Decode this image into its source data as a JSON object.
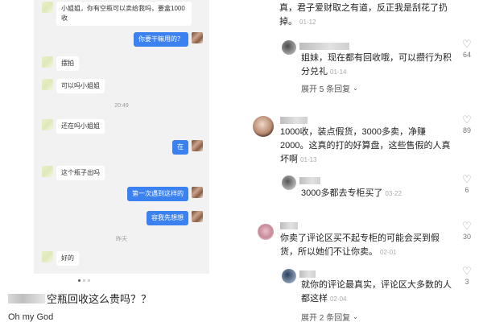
{
  "chat": {
    "messages": [
      {
        "side": "in",
        "text": "小姐姐，你有空瓶可以卖给我吗，要盒1000收"
      },
      {
        "side": "out",
        "text": "你要干嘛用的？"
      },
      {
        "side": "in",
        "text": "摆拍"
      },
      {
        "side": "in",
        "text": "可以吗小姐姐"
      },
      {
        "side": "in",
        "text": "还在吗小姐姐"
      },
      {
        "side": "out",
        "text": "在"
      },
      {
        "side": "in",
        "text": "这个瓶子出吗"
      },
      {
        "side": "out",
        "text": "第一次遇到这样的"
      },
      {
        "side": "out",
        "text": "容我先想想"
      },
      {
        "side": "in",
        "text": "好的"
      }
    ],
    "time_1": "20:49",
    "time_2": "昨天"
  },
  "post": {
    "title": "空瓶回收这么贵吗？？",
    "body": "Oh my God"
  },
  "comments": [
    {
      "name": "",
      "text": "真，君子爱财取之有道，反正我是刮花了扔掉。",
      "date": "01-12",
      "likes": "",
      "replies_link": ""
    },
    {
      "name": "",
      "text": "姐妹，现在都有回收哦，可以攒行为积分兑礼",
      "date": "01-14",
      "likes": "64",
      "replies_link": "展开 5 条回复"
    },
    {
      "name": "",
      "text": "1000收，装点假货，3000多卖，净赚2000。这真的打的好算盘，这些售假的人真坏啊",
      "date": "01-13",
      "likes": "89",
      "replies_link": ""
    },
    {
      "name": "",
      "text": "3000多都去专柜买了",
      "date": "03-22",
      "likes": "6",
      "replies_link": ""
    },
    {
      "name": "",
      "text": "你卖了评论区买不起专柜的可能会买到假货，所以她们不让你卖。",
      "date": "02-01",
      "likes": "30",
      "replies_link": ""
    },
    {
      "name": "",
      "text": "就你的评论最真实，评论区大多数的人都这样",
      "date": "02-04",
      "likes": "3",
      "replies_link": "展开 2 条回复"
    }
  ],
  "icons": {
    "like": "heart-outline-icon",
    "expand": "chevron-down-icon",
    "emoji": "pig-face-emoji-icon"
  },
  "colors": {
    "out_bubble": "#3b82f0",
    "chat_bg": "#f2f2f3",
    "muted": "#999999"
  }
}
